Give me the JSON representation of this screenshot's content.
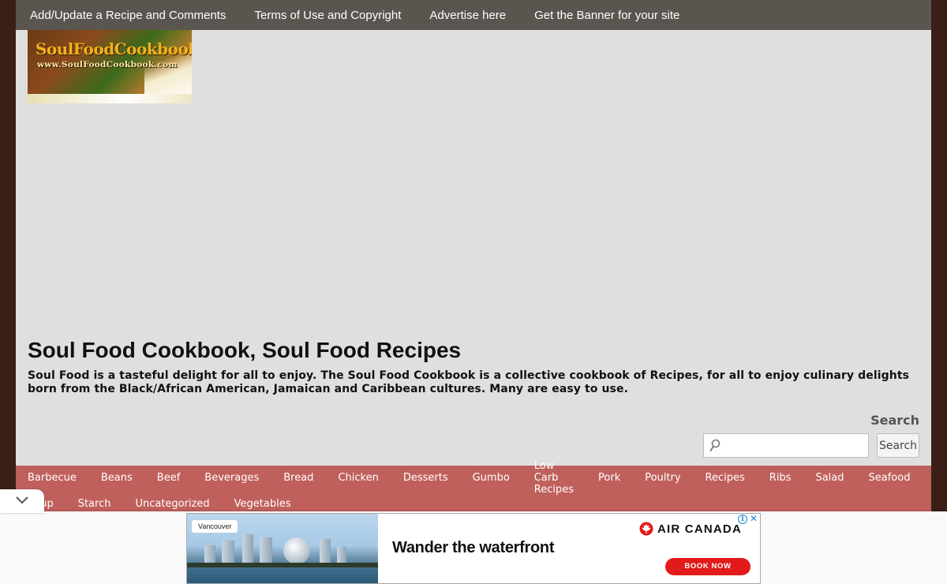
{
  "top_nav": {
    "items": [
      "Add/Update a Recipe and Comments",
      "Terms of Use and Copyright",
      "Advertise here",
      "Get the Banner for your site"
    ]
  },
  "logo": {
    "text": "SoulFoodCookbook",
    "url_text": "www.SoulFoodCookbook.com"
  },
  "site": {
    "title": "Soul Food Cookbook, Soul Food Recipes",
    "description": "Soul Food is a tasteful delight for all to enjoy. The Soul Food Cookbook is a collective cookbook of Recipes, for all to enjoy culinary delights born from the Black/African American, Jamaican and Caribbean cultures. Many are easy to use."
  },
  "search": {
    "heading": "Search",
    "value": "",
    "button_label": "Search",
    "icon": "magnifier-icon"
  },
  "categories": {
    "row1": [
      "Barbecue",
      "Beans",
      "Beef",
      "Beverages",
      "Bread",
      "Chicken",
      "Desserts",
      "Gumbo",
      "Low Carb Recipes",
      "Pork",
      "Poultry",
      "Recipes",
      "Ribs",
      "Salad",
      "Seafood"
    ],
    "row2": [
      "Soup",
      "Starch",
      "Uncategorized",
      "Vegetables"
    ]
  },
  "ad": {
    "city_tag": "Vancouver",
    "headline": "Wander the waterfront",
    "brand": "AIR CANADA",
    "cta": "BOOK NOW",
    "info": "i",
    "close": "✕"
  },
  "colors": {
    "page_background": "#3b1f17",
    "top_nav": "#5b5550",
    "content": "#e0dfdd",
    "category_nav": "#c0605c",
    "ad_cta": "#e21a1a"
  }
}
